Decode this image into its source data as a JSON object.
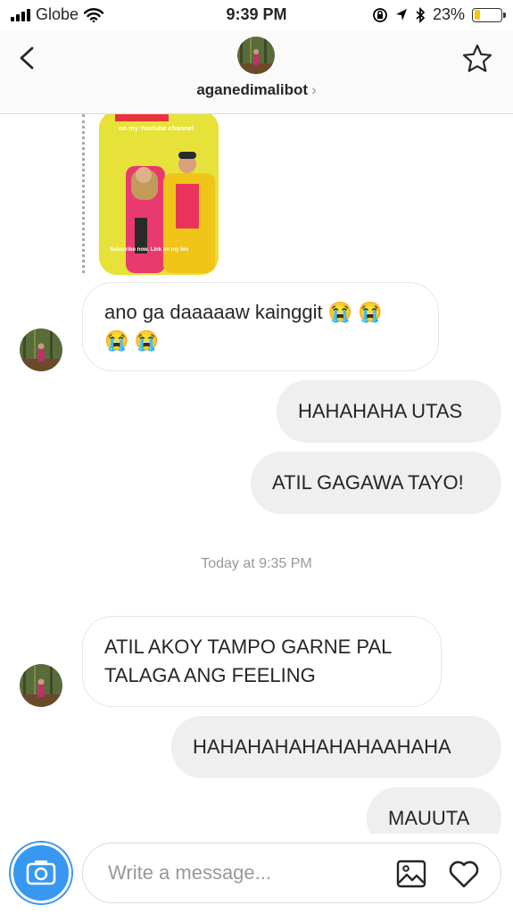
{
  "status_bar": {
    "carrier": "Globe",
    "time": "9:39 PM",
    "battery_percent": "23%",
    "battery_level": 0.23,
    "battery_color": "#f5c518"
  },
  "header": {
    "username": "aganedimalibot",
    "chevron": "›",
    "back_icon": "chevron-left-icon",
    "star_icon": "star-icon"
  },
  "story": {
    "caption": "on my Youtube channel",
    "footer": "Subscribe now. Link on my bio"
  },
  "messages": {
    "m1": {
      "sender": "them",
      "text": "ano ga daaaaaw kainggit 😭 😭\n😭 😭"
    },
    "m2": {
      "sender": "me",
      "text": "HAHAHAHA UTAS"
    },
    "m3": {
      "sender": "me",
      "text": "ATIL GAGAWA TAYO!"
    },
    "timestamp": "Today at 9:35 PM",
    "m4": {
      "sender": "them",
      "text": "ATIL AKOY TAMPO GARNE PAL\nTALAGA ANG FEELING"
    },
    "m5": {
      "sender": "me",
      "text": "HAHAHAHAHAHAHAAHAHA"
    },
    "m6": {
      "sender": "me",
      "text": "MAUUTA"
    }
  },
  "composer": {
    "placeholder": "Write a message...",
    "camera_icon": "camera-icon",
    "gallery_icon": "gallery-icon",
    "heart_icon": "heart-icon"
  },
  "colors": {
    "accent_blue": "#3897f0",
    "outgoing_bubble": "#efefef",
    "incoming_border": "#e6e6e6"
  }
}
